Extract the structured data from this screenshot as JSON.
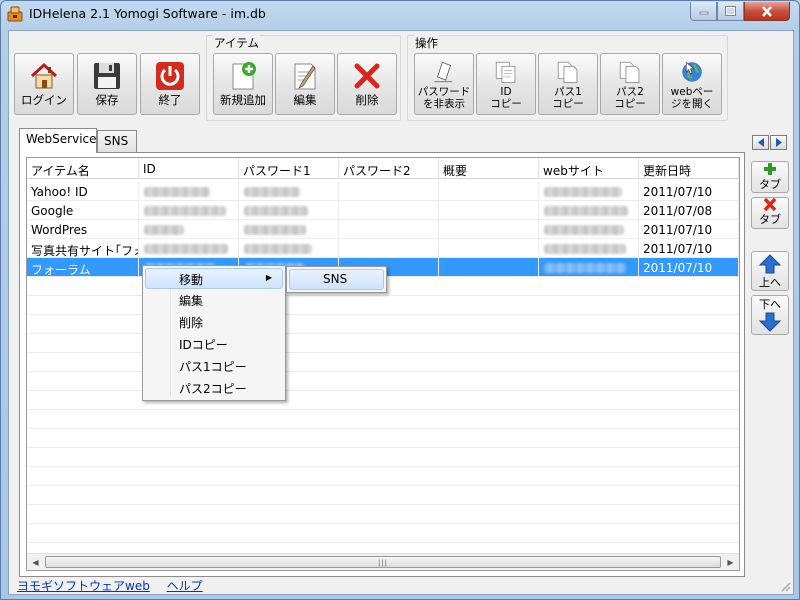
{
  "window": {
    "title": "IDHelena 2.1   Yomogi Software - im.db"
  },
  "toolbar": {
    "group_item_label": "アイテム",
    "group_ops_label": "操作",
    "login": "ログイン",
    "save": "保存",
    "exit": "終了",
    "new_item": "新規追加",
    "edit": "編集",
    "delete": "削除",
    "hide_password": "パスワード\nを非表示",
    "copy_id": "ID\nコピー",
    "copy_pass1": "パス1\nコピー",
    "copy_pass2": "パス2\nコピー",
    "open_web": "webペー\nジを開く"
  },
  "tabs": [
    "WebService",
    "SNS"
  ],
  "side_buttons": {
    "add_tab": "タブ",
    "remove_tab": "タブ",
    "move_up": "上へ",
    "move_down": "下へ"
  },
  "table": {
    "columns": [
      "アイテム名",
      "ID",
      "パスワード1",
      "パスワード2",
      "概要",
      "webサイト",
      "更新日時"
    ],
    "rows": [
      {
        "name": "Yahoo! ID",
        "updated": "2011/07/10"
      },
      {
        "name": "Google",
        "updated": "2011/07/08"
      },
      {
        "name": "WordPres",
        "updated": "2011/07/10"
      },
      {
        "name": "写真共有サイト｢フォ…",
        "updated": "2011/07/10"
      },
      {
        "name": "フォーラム",
        "updated": "2011/07/10"
      }
    ]
  },
  "context_menu": {
    "items": [
      "移動",
      "編集",
      "削除",
      "IDコピー",
      "パス1コピー",
      "パス2コピー"
    ],
    "submenu": [
      "SNS"
    ]
  },
  "footer": {
    "links": [
      "ヨモギソフトウェアweb",
      "ヘルプ"
    ]
  }
}
